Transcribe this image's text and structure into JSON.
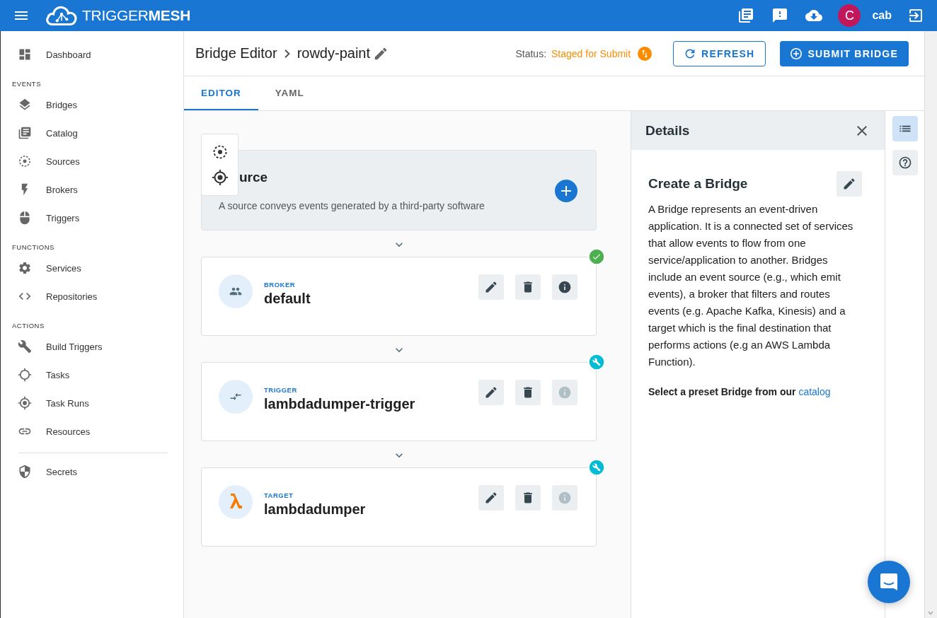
{
  "app_bar": {
    "logo": "TRIGGER**MESH**",
    "avatar": "C",
    "user": "cab"
  },
  "sidebar": {
    "sections": [
      {
        "items": [
          {
            "label": "Dashboard"
          }
        ]
      },
      {
        "heading": "EVENTS",
        "items": [
          {
            "label": "Bridges"
          },
          {
            "label": "Catalog"
          },
          {
            "label": "Sources"
          },
          {
            "label": "Brokers"
          },
          {
            "label": "Triggers"
          }
        ]
      },
      {
        "heading": "FUNCTIONS",
        "items": [
          {
            "label": "Services"
          },
          {
            "label": "Repositories"
          }
        ]
      },
      {
        "heading": "ACTIONS",
        "items": [
          {
            "label": "Build Triggers"
          },
          {
            "label": "Tasks"
          },
          {
            "label": "Task Runs"
          },
          {
            "label": "Resources"
          }
        ]
      },
      {
        "divider": true,
        "items": [
          {
            "label": "Secrets"
          }
        ]
      }
    ]
  },
  "header": {
    "title": "Bridge Editor",
    "bridge_name": "rowdy-paint",
    "status_label": "Status:",
    "status_value": "Staged for Submit",
    "buttons": [
      {
        "label": "REFRESH",
        "kind": "outlined"
      },
      {
        "label": "SUBMIT BRIDGE",
        "kind": "filled"
      }
    ]
  },
  "tabs": [
    {
      "label": "EDITOR",
      "selected": true
    },
    {
      "label": "YAML",
      "selected": false
    }
  ],
  "source_card": {
    "title": "urce",
    "description": "A source conveys events generated by a third-party software"
  },
  "nodes": [
    {
      "kind": "broker",
      "type_label": "BROKER",
      "name": "default",
      "configured": true,
      "info_disabled": false
    },
    {
      "kind": "trigger",
      "type_label": "TRIGGER",
      "name": "lambdadumper-trigger",
      "configured": false,
      "info_disabled": true
    },
    {
      "kind": "target",
      "type_label": "TARGET",
      "name": "lambdadumper",
      "configured": false,
      "info_disabled": true
    }
  ],
  "details": {
    "title": "Details",
    "heading": "Create a Bridge",
    "body": "A Bridge represents an event-driven application. It is a connected set of services that allow events to flow from one service/application to another. Bridges include an event source (e.g., which emit events), a broker that filters and routes events (e.g. Apache Kafka, Kinesis) and a target which is the final destination that performs actions (e.g an AWS Lambda Function).",
    "preset_text": "Select a preset Bridge from our",
    "preset_link": "catalog"
  },
  "rail": [
    {
      "kind": "list",
      "selected": true
    },
    {
      "kind": "help",
      "selected": false
    }
  ]
}
